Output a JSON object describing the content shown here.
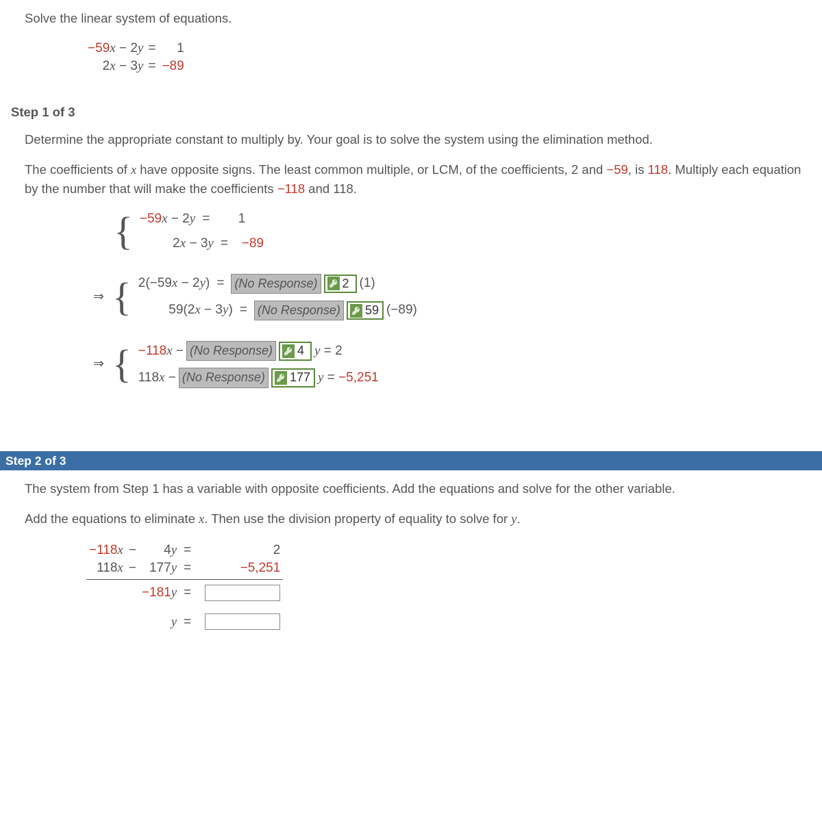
{
  "problem": {
    "instruction": "Solve the linear system of equations.",
    "eq1": {
      "lhs_a": "−59",
      "lhs_ax": "x",
      "op": " − ",
      "lhs_b": "2",
      "lhs_by": "y",
      "eq": "=",
      "rhs": "1"
    },
    "eq2": {
      "lhs_a": "2",
      "lhs_ax": "x",
      "op": " − ",
      "lhs_b": "3",
      "lhs_by": "y",
      "eq": "=",
      "rhs": "−89"
    }
  },
  "step1": {
    "header": "Step 1 of 3",
    "p1": "Determine the appropriate constant to multiply by. Your goal is to solve the system using the elimination method.",
    "p2a": "The coefficients of ",
    "p2var": "x",
    "p2b": " have opposite signs. The least common multiple, or LCM, of the coefficients, ",
    "p2c1": "2",
    "p2c2": " and ",
    "p2c3": "−59",
    "p2d": ", is ",
    "p2lcm": "118",
    "p2e": ". Multiply each equation by the number that will make the coefficients  ",
    "p2f": "−118",
    "p2g": "  and  ",
    "p2h": "118",
    "p2i": ".",
    "no_response": "(No Response)",
    "block2": {
      "row1": {
        "left": "2(−59",
        "left_x": "x",
        "left_mid": " − 2",
        "left_y": "y",
        "left_end": ")",
        "eq": "=",
        "key": "2",
        "after": " (1)"
      },
      "row2": {
        "left": "59(2",
        "left_x": "x",
        "left_mid": " − 3",
        "left_y": "y",
        "left_end": ")",
        "eq": "=",
        "key": "59",
        "after": " (−89)"
      }
    },
    "block3": {
      "row1": {
        "leftA": "−118",
        "leftA_x": "x",
        "leftA_op": " − ",
        "key": "4",
        "after_var": "y",
        "after_eq": " = ",
        "after_val": "2"
      },
      "row2": {
        "leftA": "118",
        "leftA_x": "x",
        "leftA_op": " − ",
        "key": "177",
        "after_var": "y",
        "after_eq": " = ",
        "after_val": "−5,251"
      }
    }
  },
  "step2": {
    "header": "Step 2 of 3",
    "p1": "The system from Step 1 has a variable with opposite coefficients. Add the equations and solve for the other variable.",
    "p2a": "Add the equations to eliminate ",
    "p2var": "x",
    "p2b": ". Then use the division property of equality to solve for ",
    "p2var2": "y",
    "p2c": ".",
    "sum": {
      "r1": {
        "a": "−118",
        "x": "x",
        "op": " − ",
        "b": "4",
        "y": "y",
        "eq": "=",
        "rhs": "2"
      },
      "r2": {
        "a": "118",
        "x": "x",
        "op": " − ",
        "b": "177",
        "y": "y",
        "eq": "=",
        "rhs": "−5,251"
      },
      "r3": {
        "b": "−181",
        "y": "y",
        "eq": "="
      },
      "r4": {
        "y": "y",
        "eq": "="
      }
    }
  }
}
